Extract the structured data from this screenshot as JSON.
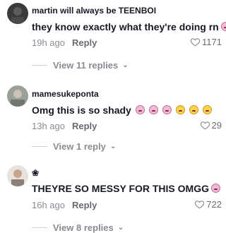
{
  "comments": [
    {
      "username": "martin will always be TEENBOI",
      "text": "they know exactly what they're doing rn",
      "emojis": [
        "crying-face"
      ],
      "time": "19h ago",
      "reply_label": "Reply",
      "likes": "1171",
      "view_replies": "View 11 replies"
    },
    {
      "username": "mamesukeponta",
      "text": "Omg this is so shady",
      "emojis": [
        "crying-face",
        "crying-face",
        "crying-face",
        "laughing-face",
        "laughing-face",
        "laughing-face"
      ],
      "time": "13h ago",
      "reply_label": "Reply",
      "likes": "29",
      "view_replies": "View 1 reply"
    },
    {
      "username": "❀",
      "text": "THEYRE SO MESSY FOR THIS OMGG",
      "emojis": [
        "crying-face"
      ],
      "time": "16h ago",
      "reply_label": "Reply",
      "likes": "722",
      "view_replies": "View 8 replies"
    }
  ],
  "colors": {
    "text": "#161823",
    "muted": "#8a8b91",
    "accent_pink": "#f3b8d6"
  }
}
